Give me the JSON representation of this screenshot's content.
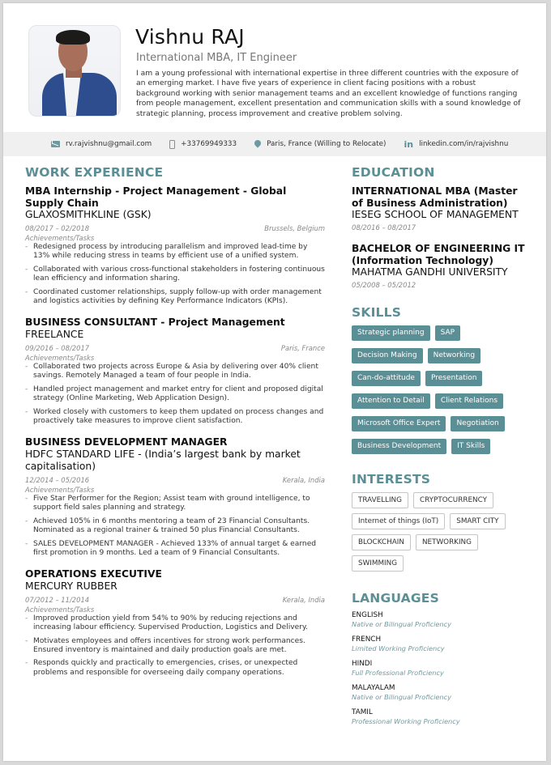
{
  "header": {
    "name": "Vishnu RAJ",
    "subtitle": "International MBA, IT Engineer",
    "summary": "I am a young professional with international expertise in three different countries with the exposure of an emerging market. I have five years of experience in client facing positions with a robust background working with senior management teams and an excellent knowledge of functions ranging from people management, excellent presentation and communication skills with a sound knowledge of strategic planning, process improvement and creative problem solving."
  },
  "contact": {
    "email": "rv.rajvishnu@gmail.com",
    "phone": "+33769949333",
    "location": "Paris, France (Willing to Relocate)",
    "linkedin": "linkedin.com/in/rajvishnu",
    "icons": [
      "mail-icon",
      "phone-icon",
      "location-pin-icon",
      "linkedin-icon"
    ]
  },
  "accent_color": "#5b8f96",
  "work": {
    "title": "WORK EXPERIENCE",
    "tasks_label": "Achievements/Tasks",
    "jobs": [
      {
        "title": "MBA Internship - Project Management - Global Supply Chain",
        "company": "GLAXOSMITHKLINE (GSK)",
        "dates": "08/2017 – 02/2018",
        "location": "Brussels, Belgium",
        "tasks": [
          "Redesigned process by introducing parallelism and improved lead-time by 13% while reducing stress in teams by efficient use of a unified system.",
          "Collaborated with various cross-functional stakeholders in fostering continuous lean efficiency and information sharing.",
          "Coordinated customer relationships, supply follow-up with order management and logistics activities by defining Key Performance Indicators (KPIs)."
        ]
      },
      {
        "title": "BUSINESS CONSULTANT - Project Management",
        "company": "FREELANCE",
        "dates": "09/2016 – 08/2017",
        "location": "Paris, France",
        "tasks": [
          "Collaborated two projects across Europe & Asia by delivering over 40% client savings. Remotely Managed a team of four people in India.",
          "Handled project management and market entry for client and proposed digital strategy (Online Marketing, Web Application Design).",
          "Worked closely with customers to keep them updated on process changes and proactively take measures to improve client satisfaction."
        ]
      },
      {
        "title": "BUSINESS DEVELOPMENT MANAGER",
        "company": "HDFC STANDARD LIFE - (India’s largest bank by market capitalisation)",
        "dates": "12/2014 – 05/2016",
        "location": "Kerala, India",
        "tasks": [
          "Five Star Performer for the Region; Assist team with ground intelligence, to support field sales planning and strategy.",
          "Achieved 105% in 6 months mentoring a team of 23 Financial Consultants. Nominated as a regional trainer & trained 50 plus Financial Consultants.",
          "SALES DEVELOPMENT MANAGER - Achieved 133% of annual target & earned first promotion in 9 months. Led a team of 9 Financial Consultants."
        ]
      },
      {
        "title": "OPERATIONS EXECUTIVE",
        "company": "MERCURY RUBBER",
        "dates": "07/2012 – 11/2014",
        "location": "Kerala, India",
        "tasks": [
          "Improved production yield from 54% to 90% by reducing rejections and increasing labour efficiency. Supervised Production, Logistics and Delivery.",
          "Motivates employees and offers incentives for strong work performances. Ensured inventory is maintained and daily production goals are met.",
          "Responds quickly and practically to emergencies, crises, or unexpected problems and responsible for overseeing daily company operations."
        ]
      }
    ]
  },
  "education": {
    "title": "EDUCATION",
    "items": [
      {
        "degree": "INTERNATIONAL MBA (Master of Business Administration)",
        "school": "IESEG SCHOOL OF MANAGEMENT",
        "dates": "08/2016 – 08/2017"
      },
      {
        "degree": "BACHELOR OF ENGINEERING IT (Information Technology)",
        "school": "MAHATMA GANDHI UNIVERSITY",
        "dates": "05/2008 – 05/2012"
      }
    ]
  },
  "skills": {
    "title": "SKILLS",
    "items": [
      "Strategic planning",
      "SAP",
      "Decision Making",
      "Networking",
      "Can-do-attitude",
      "Presentation",
      "Attention to Detail",
      "Client Relations",
      "Microsoft Office Expert",
      "Negotiation",
      "Business Development",
      "IT Skills"
    ]
  },
  "interests": {
    "title": "INTERESTS",
    "items": [
      "TRAVELLING",
      "CRYPTOCURRENCY",
      "Internet of things (IoT)",
      "SMART CITY",
      "BLOCKCHAIN",
      "NETWORKING",
      "SWIMMING"
    ]
  },
  "languages": {
    "title": "LANGUAGES",
    "items": [
      {
        "name": "ENGLISH",
        "level": "Native or Bilingual Proficiency"
      },
      {
        "name": "FRENCH",
        "level": "Limited Working Proficiency"
      },
      {
        "name": "HINDI",
        "level": "Full Professional Proficiency"
      },
      {
        "name": "MALAYALAM",
        "level": "Native or Bilingual Proficiency"
      },
      {
        "name": "TAMIL",
        "level": "Professional Working Proficiency"
      }
    ]
  }
}
